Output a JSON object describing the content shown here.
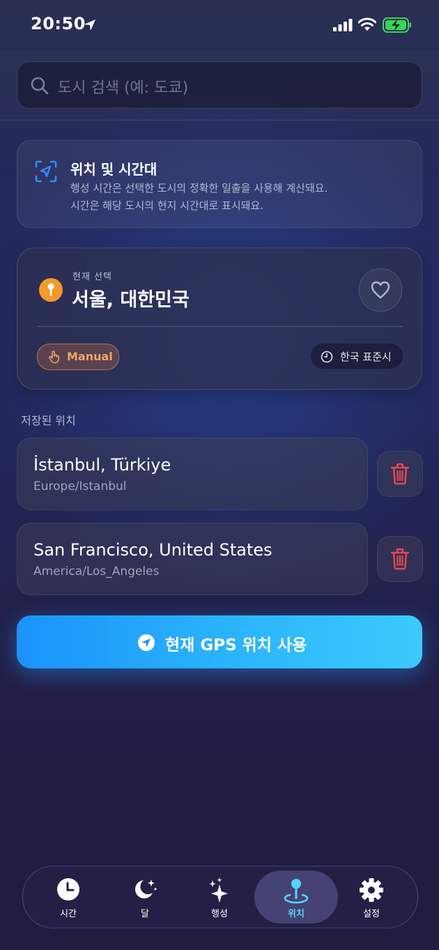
{
  "status_bar": {
    "time": "20:50"
  },
  "search": {
    "placeholder": "도시 검색 (예: 도쿄)"
  },
  "info": {
    "title": "위치 및 시간대",
    "line1": "행성 시간은 선택한 도시의 정확한 일출을 사용해 계산돼요.",
    "line2": "시간은 해당 도시의 현지 시간대로 표시돼요."
  },
  "current": {
    "caption": "현재 선택",
    "city": "서울, 대한민국",
    "mode_label": "Manual",
    "timezone_label": "한국 표준시"
  },
  "saved": {
    "heading": "저장된 위치",
    "items": [
      {
        "name": "İstanbul, Türkiye",
        "timezone": "Europe/Istanbul"
      },
      {
        "name": "San Francisco, United States",
        "timezone": "America/Los_Angeles"
      }
    ]
  },
  "gps_button": {
    "label": "현재 GPS 위치 사용"
  },
  "tabs": [
    {
      "label": "시간",
      "icon": "clock-icon"
    },
    {
      "label": "달",
      "icon": "moon-icon"
    },
    {
      "label": "행성",
      "icon": "sparkle-icon"
    },
    {
      "label": "위치",
      "icon": "location-pin-icon",
      "active": true
    },
    {
      "label": "설정",
      "icon": "gear-icon"
    }
  ],
  "colors": {
    "accent_blue": "#1a93fb",
    "accent_cyan": "#56d4f8",
    "pin_orange": "#f39a2a",
    "delete_red": "#e8484f"
  }
}
